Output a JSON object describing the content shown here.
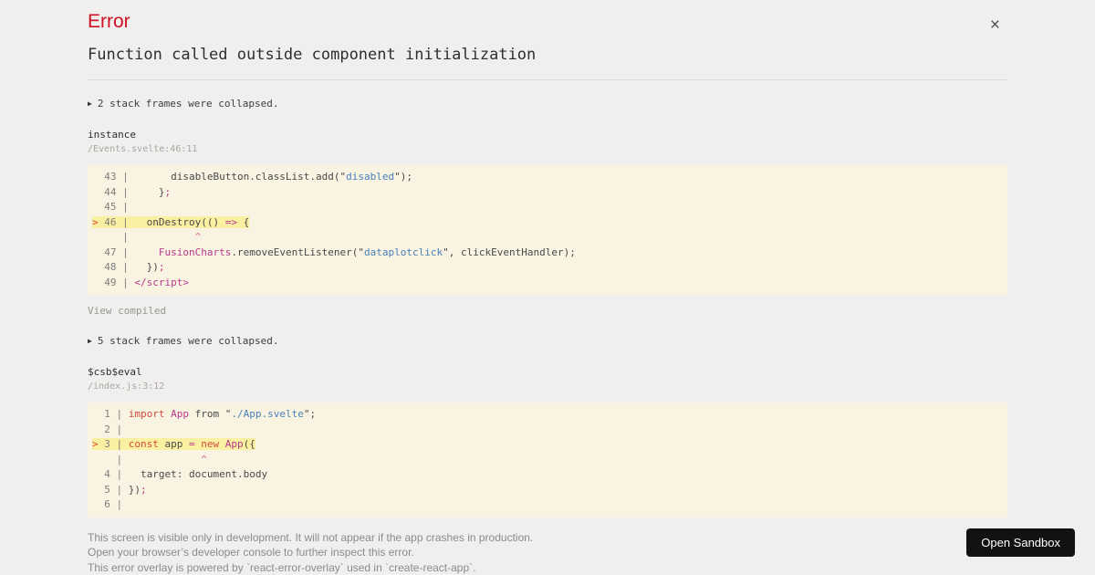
{
  "header": {
    "title": "Error",
    "close_icon": "×"
  },
  "error_message": "Function called outside component initialization",
  "icons": {
    "triangle_right": "▶"
  },
  "sections": [
    {
      "collapsed_label": "2 stack frames were collapsed.",
      "function_name": "instance",
      "location": "/Events.svelte:46:11",
      "action_label": "View compiled"
    },
    {
      "collapsed_label": "5 stack frames were collapsed.",
      "function_name": "$csb$eval",
      "location": "/index.js:3:12"
    }
  ],
  "code_blocks": {
    "events_svelte": [
      {
        "t": [
          [
            "g",
            "  43 | "
          ],
          [
            "p",
            "      disableButton.classList.add(\""
          ],
          [
            "s",
            "disabled"
          ],
          [
            "p",
            "\");"
          ]
        ]
      },
      {
        "t": [
          [
            "g",
            "  44 | "
          ],
          [
            "p",
            "    }"
          ],
          [
            "o",
            ";"
          ]
        ]
      },
      {
        "t": [
          [
            "g",
            "  45 | "
          ]
        ]
      },
      {
        "hl": true,
        "t": [
          [
            "m",
            "> "
          ],
          [
            "g",
            "46 | "
          ],
          [
            "p",
            "  onDestroy(() "
          ],
          [
            "o",
            "=>"
          ],
          [
            "p",
            " {"
          ]
        ]
      },
      {
        "t": [
          [
            "g",
            "     | "
          ],
          [
            "caret",
            "          ^"
          ]
        ]
      },
      {
        "t": [
          [
            "g",
            "  47 | "
          ],
          [
            "p",
            "    "
          ],
          [
            "cl",
            "FusionCharts"
          ],
          [
            "p",
            ".removeEventListener(\""
          ],
          [
            "s",
            "dataplotclick"
          ],
          [
            "p",
            "\", clickEventHandler);"
          ]
        ]
      },
      {
        "t": [
          [
            "g",
            "  48 | "
          ],
          [
            "p",
            "  })"
          ],
          [
            "o",
            ";"
          ]
        ]
      },
      {
        "t": [
          [
            "g",
            "  49 | "
          ],
          [
            "tag",
            "</script>"
          ]
        ]
      }
    ],
    "index_js": [
      {
        "t": [
          [
            "g",
            "  1 | "
          ],
          [
            "k",
            "import"
          ],
          [
            "p",
            " "
          ],
          [
            "cl",
            "App"
          ],
          [
            "p",
            " from \""
          ],
          [
            "s",
            "./App.svelte"
          ],
          [
            "p",
            "\";"
          ]
        ]
      },
      {
        "t": [
          [
            "g",
            "  2 | "
          ]
        ]
      },
      {
        "hl": true,
        "t": [
          [
            "m",
            "> "
          ],
          [
            "g",
            "3 | "
          ],
          [
            "k",
            "const"
          ],
          [
            "p",
            " app "
          ],
          [
            "o",
            "="
          ],
          [
            "p",
            " "
          ],
          [
            "k",
            "new"
          ],
          [
            "p",
            " "
          ],
          [
            "cl",
            "App"
          ],
          [
            "p",
            "({"
          ]
        ]
      },
      {
        "t": [
          [
            "g",
            "    | "
          ],
          [
            "caret",
            "            ^"
          ]
        ]
      },
      {
        "t": [
          [
            "g",
            "  4 | "
          ],
          [
            "p",
            "  target: document.body"
          ]
        ]
      },
      {
        "t": [
          [
            "g",
            "  5 | "
          ],
          [
            "p",
            "})"
          ],
          [
            "o",
            ";"
          ]
        ]
      },
      {
        "t": [
          [
            "g",
            "  6 | "
          ]
        ]
      }
    ]
  },
  "footer": {
    "lines": [
      "This screen is visible only in development. It will not appear if the app crashes in production.",
      "Open your browser’s developer console to further inspect this error.",
      "This error overlay is powered by `react-error-overlay` used in `create-react-app`."
    ]
  },
  "sandbox_button_label": "Open Sandbox",
  "colors": {
    "error_red": "#ce1126",
    "page_background": "#f0efee",
    "code_frame_background": "#f8f4e1",
    "error_line_highlight": "#faf0a2",
    "keyword": "#d14b3e",
    "class_name": "#b8388c",
    "string": "#4a7fbb",
    "button_background": "#121212"
  }
}
